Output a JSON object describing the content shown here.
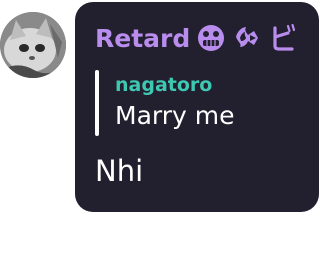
{
  "message": {
    "author": "Retard",
    "author_color": "#b98dee",
    "author_badges": [
      "grimace-face-emoji",
      "fire-arrow-emoji",
      "katakana-bi-emoji"
    ],
    "reply": {
      "author": "nagatoro",
      "author_color": "#3ec8b2",
      "text": "Marry me"
    },
    "text": "Nhi",
    "bubble_color": "#221f2e"
  }
}
